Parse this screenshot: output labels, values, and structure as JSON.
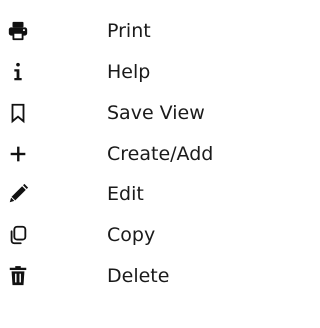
{
  "menu": {
    "items": [
      {
        "label": "Print",
        "icon": "printer-icon"
      },
      {
        "label": "Help",
        "icon": "info-icon"
      },
      {
        "label": "Save View",
        "icon": "bookmark-icon"
      },
      {
        "label": "Create/Add",
        "icon": "plus-icon"
      },
      {
        "label": "Edit",
        "icon": "pencil-icon"
      },
      {
        "label": "Copy",
        "icon": "copy-icon"
      },
      {
        "label": "Delete",
        "icon": "trash-icon"
      }
    ]
  },
  "colors": {
    "text": "#1a1a1a",
    "icon": "#111111",
    "background": "#ffffff"
  }
}
